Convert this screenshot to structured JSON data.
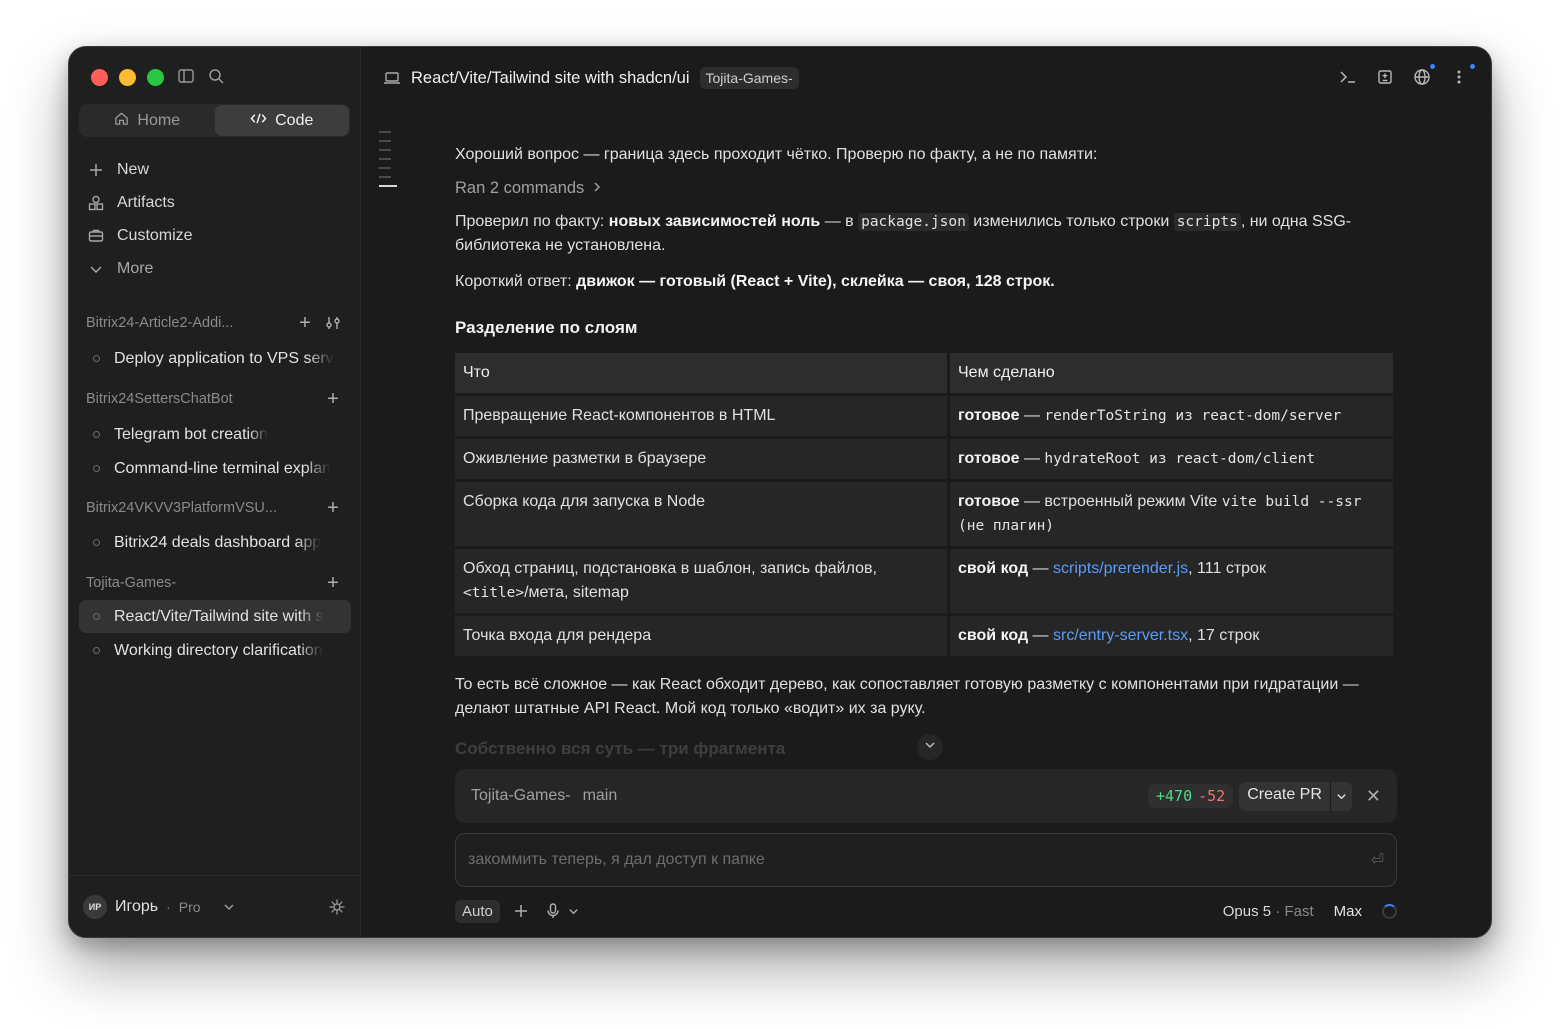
{
  "sidebar": {
    "tabs": {
      "home": "Home",
      "code": "Code"
    },
    "nav": {
      "new": "New",
      "artifacts": "Artifacts",
      "customize": "Customize",
      "more": "More"
    },
    "projects": [
      {
        "name": "Bitrix24-Article2-Addi...",
        "sessions": [
          "Deploy application to VPS serv"
        ]
      },
      {
        "name": "Bitrix24SettersChatBot",
        "sessions": [
          "Telegram bot creation",
          "Command-line terminal explan"
        ]
      },
      {
        "name": "Bitrix24VKVV3PlatformVSU...",
        "sessions": [
          "Bitrix24 deals dashboard app"
        ]
      },
      {
        "name": "Tojita-Games-",
        "sessions": [
          "React/Vite/Tailwind site with s",
          "Working directory clarification"
        ]
      }
    ],
    "user": {
      "initials": "ИР",
      "name": "Игорь",
      "sep": "·",
      "plan": "Pro"
    }
  },
  "topbar": {
    "title": "React/Vite/Tailwind site with shadcn/ui",
    "badge": "Tojita-Games-"
  },
  "chat": {
    "intro": "Хороший вопрос — граница здесь проходит чётко. Проверю по факту, а не по памяти:",
    "ran": "Ran 2 commands",
    "p1": {
      "a": "Проверил по факту: ",
      "b": "новых зависимостей ноль",
      "c": " — в ",
      "code1": "package.json",
      "d": " изменились только строки ",
      "code2": "scripts",
      "e": ", ни одна SSG-библиотека не установлена."
    },
    "p2": {
      "a": "Короткий ответ: ",
      "b": "движок — готовый (React + Vite), склейка — своя, 128 строк."
    },
    "heading": "Разделение по слоям",
    "table": {
      "headers": [
        "Что",
        "Чем сделано"
      ],
      "rows": [
        {
          "what": "Превращение React-компонентов в HTML",
          "how_b": "готовое",
          "how_sep": " — ",
          "how_rest": "renderToString из react-dom/server"
        },
        {
          "what": "Оживление разметки в браузере",
          "how_b": "готовое",
          "how_sep": " — ",
          "how_rest": "hydrateRoot из react-dom/client"
        },
        {
          "what": "Сборка кода для запуска в Node",
          "how_b": "готовое",
          "how_sep": " — ",
          "how_text": "встроенный режим Vite ",
          "how_mono": "vite build --ssr",
          "how_tail": " (не плагин)"
        },
        {
          "what_a": "Обход страниц, подстановка в шаблон, запись файлов, ",
          "what_mono": "<title>",
          "what_b": "/мета, sitemap",
          "how_b": "свой код",
          "how_sep": " — ",
          "how_link": "scripts/prerender.js",
          "how_tail": ", 111 строк"
        },
        {
          "what": "Точка входа для рендера",
          "how_b": "свой код",
          "how_sep": " — ",
          "how_link": "src/entry-server.tsx",
          "how_tail": ", 17 строк"
        }
      ]
    },
    "p3": "То есть всё сложное — как React обходит дерево, как сопоставляет готовую разметку с компонентами при гидратации — делают штатные API React. Мой код только «водит» их за руку.",
    "fade": "Собственно вся суть — три фрагмента"
  },
  "git": {
    "repo": "Tojita-Games-",
    "branch": "main",
    "added": "+470",
    "removed": "-52",
    "pr": "Create PR"
  },
  "composer": {
    "placeholder": "закоммить теперь, я дал доступ к папке"
  },
  "bottom": {
    "mode": "Auto",
    "model": "Opus 5",
    "sep": " · ",
    "speed": "Fast",
    "effort": "Max"
  },
  "colors": {
    "link": "#5a9cf8",
    "added": "#4ade80",
    "removed": "#f87171",
    "accent": "#3b82f6"
  }
}
